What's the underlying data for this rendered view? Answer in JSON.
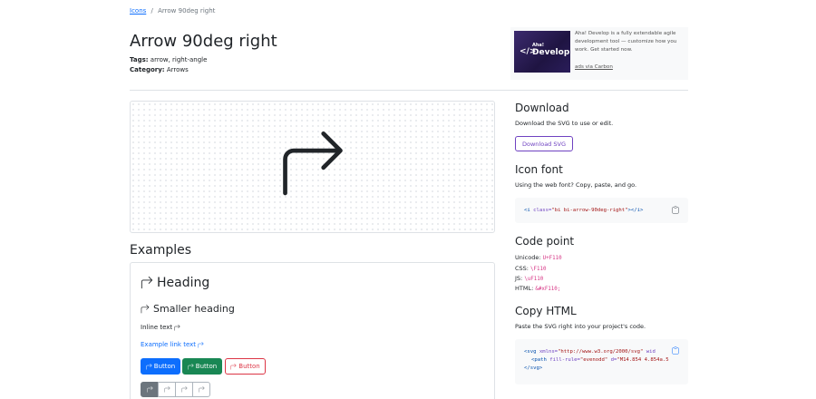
{
  "breadcrumb": {
    "link": "Icons",
    "sep": "/",
    "current": "Arrow 90deg right"
  },
  "page": {
    "title": "Arrow 90deg right",
    "tags_label": "Tags:",
    "tags_value": " arrow, right-angle",
    "category_label": "Category:",
    "category_value": " Arrows"
  },
  "ad": {
    "img_symbol": "</>",
    "img_line1": "Aha!",
    "img_line2": "Develop",
    "text": "Aha! Develop is a fully extendable agile development tool — customize how you work. Get started now.",
    "link": "ads via Carbon"
  },
  "examples": {
    "heading": "Examples",
    "h_large": "Heading",
    "h_small": "Smaller heading",
    "inline": "Inline text",
    "link": "Example link text",
    "btn_primary": "Button",
    "btn_success": "Button",
    "btn_danger": "Button"
  },
  "download": {
    "heading": "Download",
    "desc": "Download the SVG to use or edit.",
    "button": "Download SVG"
  },
  "icon_font": {
    "heading": "Icon font",
    "desc": "Using the web font? Copy, paste, and go.",
    "code_open": "<i ",
    "code_attr": "class=",
    "code_val": "\"bi bi-arrow-90deg-right\"",
    "code_close": "></i>"
  },
  "code_point": {
    "heading": "Code point",
    "unicode_label": "Unicode: ",
    "unicode_value": "U+F110",
    "css_label": "CSS: ",
    "css_value": "\\F110",
    "js_label": "JS: ",
    "js_value": "\\uF110",
    "html_label": "HTML: ",
    "html_value": "&#xF110;"
  },
  "copy_html": {
    "heading": "Copy HTML",
    "desc": "Paste the SVG right into your project's code.",
    "l1_tag": "<svg ",
    "l1_attr": "xmlns=",
    "l1_val": "\"http://www.w3.org/2000/svg\"",
    "l1_more": " wid",
    "l2_tag": "<path ",
    "l2_attr1": "fill-rule=",
    "l2_val1": "\"evenodd\"",
    "l2_attr2": " d=",
    "l2_val2": "\"M14.854 4.854a.5",
    "l3": "</svg>"
  },
  "colors": {
    "primary": "#0d6efd",
    "success": "#198754",
    "danger": "#dc3545",
    "purple": "#6f42c1",
    "code_pink": "#d63384"
  },
  "icons": {
    "main": "arrow-90deg-right-icon",
    "copy": "clipboard-icon"
  }
}
